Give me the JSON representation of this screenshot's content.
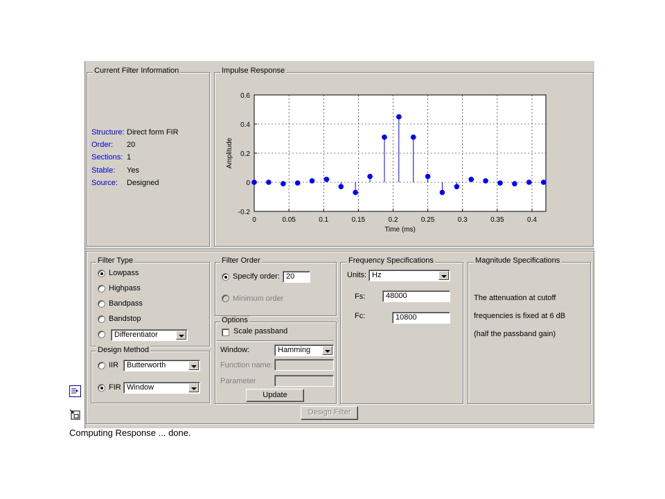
{
  "current_info": {
    "title": "Current Filter Information",
    "rows": [
      {
        "key": "Structure:",
        "value": "Direct form FIR"
      },
      {
        "key": "Order:",
        "value": "20"
      },
      {
        "key": "Sections:",
        "value": "1"
      },
      {
        "key": "Stable:",
        "value": "Yes"
      },
      {
        "key": "Source:",
        "value": "Designed"
      }
    ]
  },
  "impulse": {
    "title": "Impulse Response"
  },
  "chart_data": {
    "type": "scatter",
    "title": "",
    "xlabel": "Time (ms)",
    "ylabel": "Amplitude",
    "xlim": [
      0,
      0.42
    ],
    "ylim": [
      -0.2,
      0.6
    ],
    "xticks": [
      "0",
      "0.05",
      "0.1",
      "0.15",
      "0.2",
      "0.25",
      "0.3",
      "0.35",
      "0.4"
    ],
    "yticks": [
      "0.6",
      "0.4",
      "0.2",
      "0",
      "-0.2"
    ],
    "grid": true,
    "marker": "stem",
    "x": [
      0,
      0.0208,
      0.0417,
      0.0625,
      0.0833,
      0.1042,
      0.125,
      0.1458,
      0.1667,
      0.1875,
      0.2083,
      0.2292,
      0.25,
      0.2708,
      0.2917,
      0.3125,
      0.3333,
      0.3542,
      0.375,
      0.3958,
      0.4167
    ],
    "y": [
      0,
      0,
      -0.01,
      -0.005,
      0.01,
      0.02,
      -0.03,
      -0.07,
      0.04,
      0.31,
      0.45,
      0.31,
      0.04,
      -0.07,
      -0.03,
      0.02,
      0.01,
      -0.005,
      -0.01,
      0,
      0
    ],
    "color": "#0000ff"
  },
  "filter_type": {
    "title": "Filter Type",
    "options": [
      "Lowpass",
      "Highpass",
      "Bandpass",
      "Bandstop"
    ],
    "selected": "Lowpass",
    "other_value": "Differentiator"
  },
  "design_method": {
    "title": "Design Method",
    "iir_label": "IIR",
    "iir_value": "Butterworth",
    "fir_label": "FIR",
    "fir_value": "Window",
    "selected": "FIR"
  },
  "filter_order": {
    "title": "Filter Order",
    "specify_label": "Specify order:",
    "specify_value": "20",
    "minimum_label": "Minimum order"
  },
  "options": {
    "title": "Options",
    "scale_label": "Scale passband",
    "window_label": "Window:",
    "window_value": "Hamming",
    "function_label": "Function name:",
    "parameter_label": "Parameter",
    "update_label": "Update"
  },
  "freq": {
    "title": "Frequency Specifications",
    "units_label": "Units:",
    "units_value": "Hz",
    "fs_label": "Fs:",
    "fs_value": "48000",
    "fc_label": "Fc:",
    "fc_value": "10800"
  },
  "mag": {
    "title": "Magnitude Specifications",
    "line1": "The attenuation at cutoff",
    "line2": "frequencies is fixed at 6 dB",
    "line3": "(half the passband gain)"
  },
  "design_button": "Design Filter",
  "status": "Computing Response ... done."
}
